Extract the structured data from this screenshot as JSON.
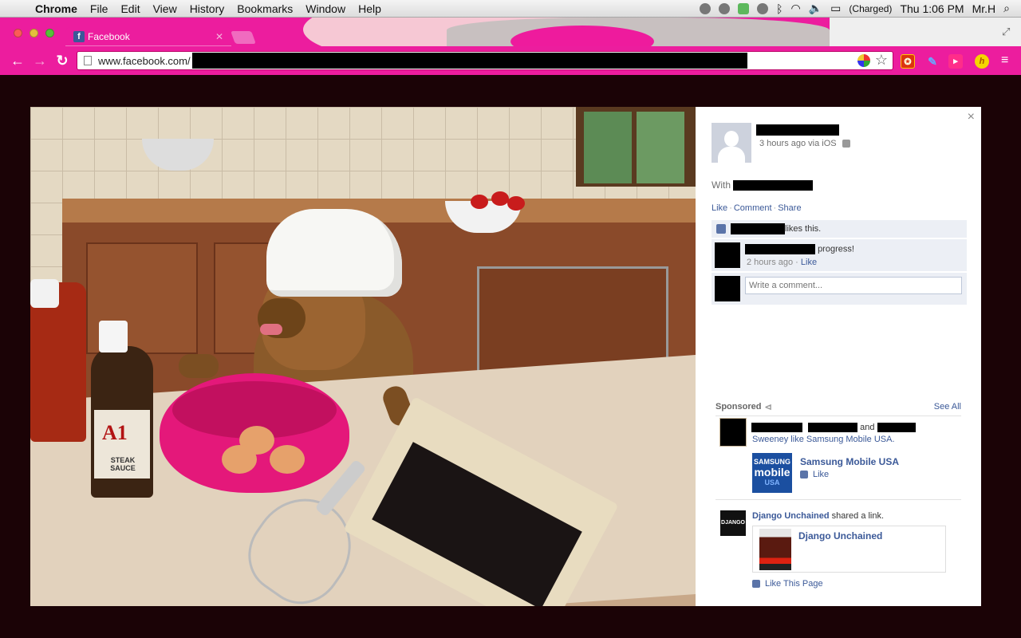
{
  "menubar": {
    "app": "Chrome",
    "menus": [
      "File",
      "Edit",
      "View",
      "History",
      "Bookmarks",
      "Window",
      "Help"
    ],
    "battery": "(Charged)",
    "clock": "Thu 1:06 PM",
    "user": "Mr.H"
  },
  "browser": {
    "tab_title": "Facebook",
    "url": "www.facebook.com/",
    "theme_color": "#ec1d9e"
  },
  "photo": {
    "sauce_brand": "A1",
    "sauce_label": "STEAK SAUCE"
  },
  "post": {
    "meta": "3 hours ago via iOS",
    "with_label": "With",
    "actions": [
      "Like",
      "Comment",
      "Share"
    ],
    "likes_text": "likes this.",
    "comment_text": "progress!",
    "comment_time": "2 hours ago",
    "comment_like": "Like",
    "write_placeholder": "Write a comment...",
    "close": "×"
  },
  "sponsored": {
    "heading": "Sponsored",
    "see_all": "See All",
    "ad1_and": "and",
    "ad1_line2": "Sweeney like Samsung Mobile USA.",
    "samsung_logo_top": "SAMSUNG",
    "samsung_logo_mid": "mobile",
    "samsung_logo_bottom": "USA",
    "samsung_name": "Samsung Mobile USA",
    "samsung_like": "Like",
    "django_logo": "DJANGO",
    "django_actor": "Django Unchained",
    "django_action": "shared a link.",
    "django_title": "Django Unchained",
    "like_page": "Like This Page"
  }
}
